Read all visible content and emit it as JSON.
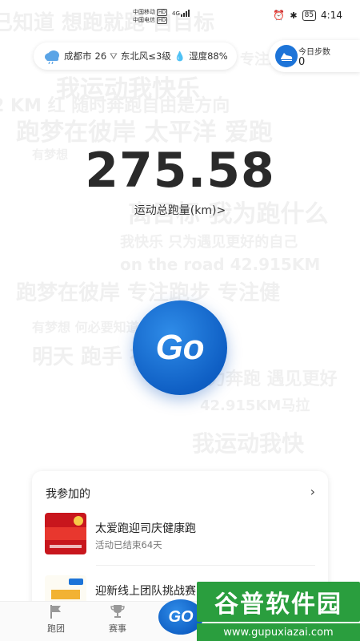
{
  "status_bar": {
    "carrier_1": "中国移动",
    "carrier_2": "中国电信",
    "network": "4G",
    "battery": "85",
    "time": "4:14"
  },
  "weather": {
    "city": "成都市",
    "temperature": "26",
    "wind": "东北风≤3级",
    "humidity": "湿度88%",
    "icon": "cloud-rain-icon"
  },
  "steps": {
    "label": "今日步数",
    "value": "0",
    "icon": "shoe-icon"
  },
  "summary": {
    "distance": "275.58",
    "distance_label": "运动总跑量(km)>"
  },
  "go_button": {
    "label": "Go"
  },
  "card": {
    "title": "我参加的",
    "events": [
      {
        "name": "太爱跑迎司庆健康跑",
        "status": "活动已结束64天"
      },
      {
        "name": "迎新线上团队挑战赛",
        "status": ""
      }
    ]
  },
  "bottom_nav": {
    "items": [
      {
        "label": "跑团",
        "icon": "flag-icon"
      },
      {
        "label": "赛事",
        "icon": "trophy-icon"
      }
    ],
    "go_label": "GO"
  },
  "watermark": {
    "text": "谷普软件园",
    "url": "www.gupuxiazai.com"
  },
  "background_lines": [
    "已知道 想跑就跑 自目标",
    "专注跑步",
    "我运动我快乐",
    "2 KM 红 随时奔跑自由是方向",
    "跑梦在彼岸 太平洋 爱跑",
    "有梦想",
    "离目标 我为跑什么",
    "我快乐 只为遇见更好的自己",
    "on the road 42.915KM",
    "跑梦在彼岸 专注跑步 专注健",
    "有梦想 何必要知道 跑吧",
    "明天 跑手 在彼岸",
    "力奔跑 遇见更好",
    "42.915KM马拉",
    "我运动我快"
  ],
  "colors": {
    "accent": "#1d74d8",
    "go_blue": "#0f5fc4",
    "watermark_green": "#2a9e3e"
  }
}
